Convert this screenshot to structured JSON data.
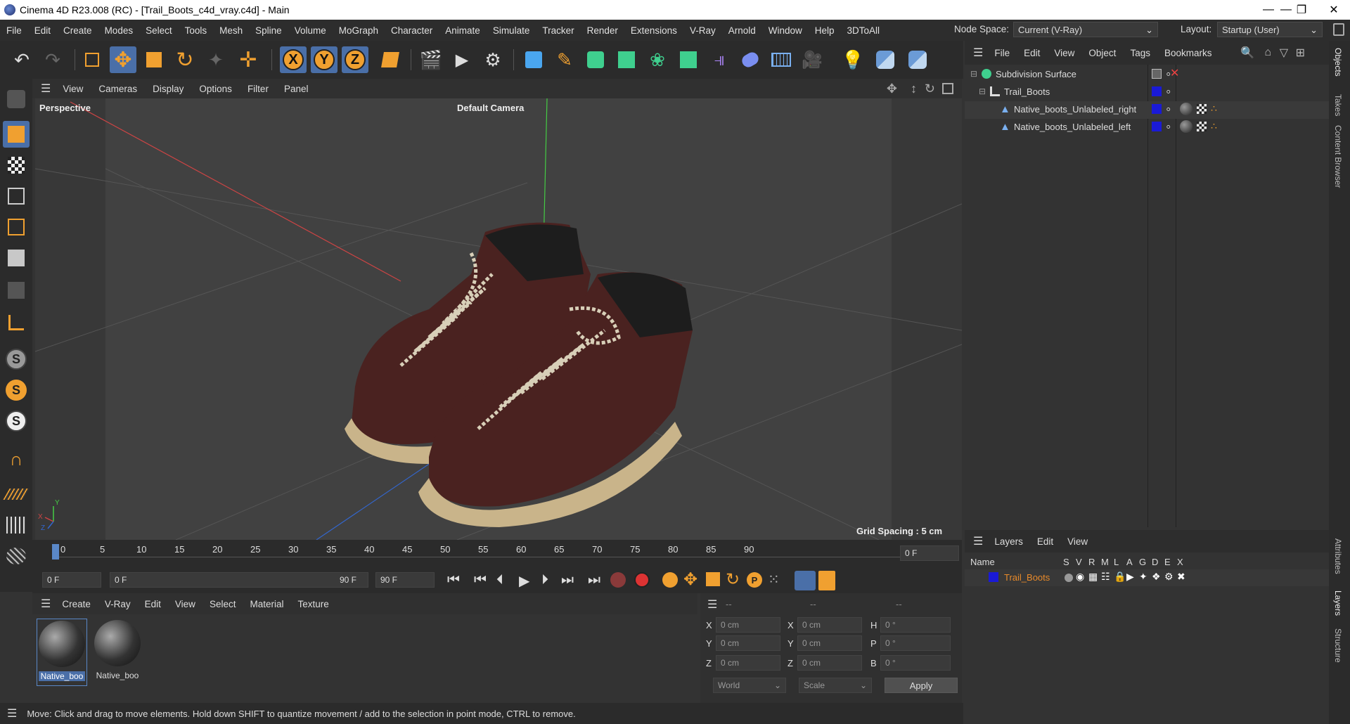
{
  "window": {
    "title": "Cinema 4D R23.008 (RC) - [Trail_Boots_c4d_vray.c4d] - Main"
  },
  "menus": [
    "File",
    "Edit",
    "Create",
    "Modes",
    "Select",
    "Tools",
    "Mesh",
    "Spline",
    "Volume",
    "MoGraph",
    "Character",
    "Animate",
    "Simulate",
    "Tracker",
    "Render",
    "Extensions",
    "V-Ray",
    "Arnold",
    "Window",
    "Help",
    "3DToAll"
  ],
  "node_space": {
    "label": "Node Space:",
    "value": "Current (V-Ray)"
  },
  "layout": {
    "label": "Layout:",
    "value": "Startup (User)"
  },
  "viewport": {
    "menu": [
      "View",
      "Cameras",
      "Display",
      "Options",
      "Filter",
      "Panel"
    ],
    "label": "Perspective",
    "camera": "Default Camera",
    "grid_spacing": "Grid Spacing : 5 cm"
  },
  "timeline": {
    "ticks": [
      "0",
      "5",
      "10",
      "15",
      "20",
      "25",
      "30",
      "35",
      "40",
      "45",
      "50",
      "55",
      "60",
      "65",
      "70",
      "75",
      "80",
      "85",
      "90"
    ],
    "current_frame": "0 F"
  },
  "transport": {
    "start": "0 F",
    "range_start": "0 F",
    "range_end": "90 F",
    "end": "90 F"
  },
  "materials": {
    "menu": [
      "Create",
      "V-Ray",
      "Edit",
      "View",
      "Select",
      "Material",
      "Texture"
    ],
    "items": [
      "Native_boo",
      "Native_boo"
    ]
  },
  "coords": {
    "headers": [
      "--",
      "--",
      "--"
    ],
    "rows": [
      {
        "a": "X",
        "av": "0 cm",
        "b": "X",
        "bv": "0 cm",
        "c": "H",
        "cv": "0 °"
      },
      {
        "a": "Y",
        "av": "0 cm",
        "b": "Y",
        "bv": "0 cm",
        "c": "P",
        "cv": "0 °"
      },
      {
        "a": "Z",
        "av": "0 cm",
        "b": "Z",
        "bv": "0 cm",
        "c": "B",
        "cv": "0 °"
      }
    ],
    "mode1": "World",
    "mode2": "Scale",
    "apply": "Apply"
  },
  "status": "Move: Click and drag to move elements. Hold down SHIFT to quantize movement / add to the selection in point mode, CTRL to remove.",
  "objects": {
    "menu": [
      "File",
      "Edit",
      "View",
      "Object",
      "Tags",
      "Bookmarks"
    ],
    "tree": [
      "Subdivision Surface",
      "Trail_Boots",
      "Native_boots_Unlabeled_right",
      "Native_boots_Unlabeled_left"
    ]
  },
  "layers": {
    "menu": [
      "Layers",
      "Edit",
      "View"
    ],
    "name_header": "Name",
    "cols": [
      "S",
      "V",
      "R",
      "M",
      "L",
      "A",
      "G",
      "D",
      "E",
      "X"
    ],
    "item": "Trail_Boots"
  },
  "side_tabs": [
    "Objects",
    "Takes",
    "Content Browser",
    "Attributes",
    "Layers",
    "Structure"
  ],
  "colors": {
    "accent": "#3d7be0",
    "layer_blue": "#1a1ad6",
    "layer_text": "#e88a2a"
  }
}
